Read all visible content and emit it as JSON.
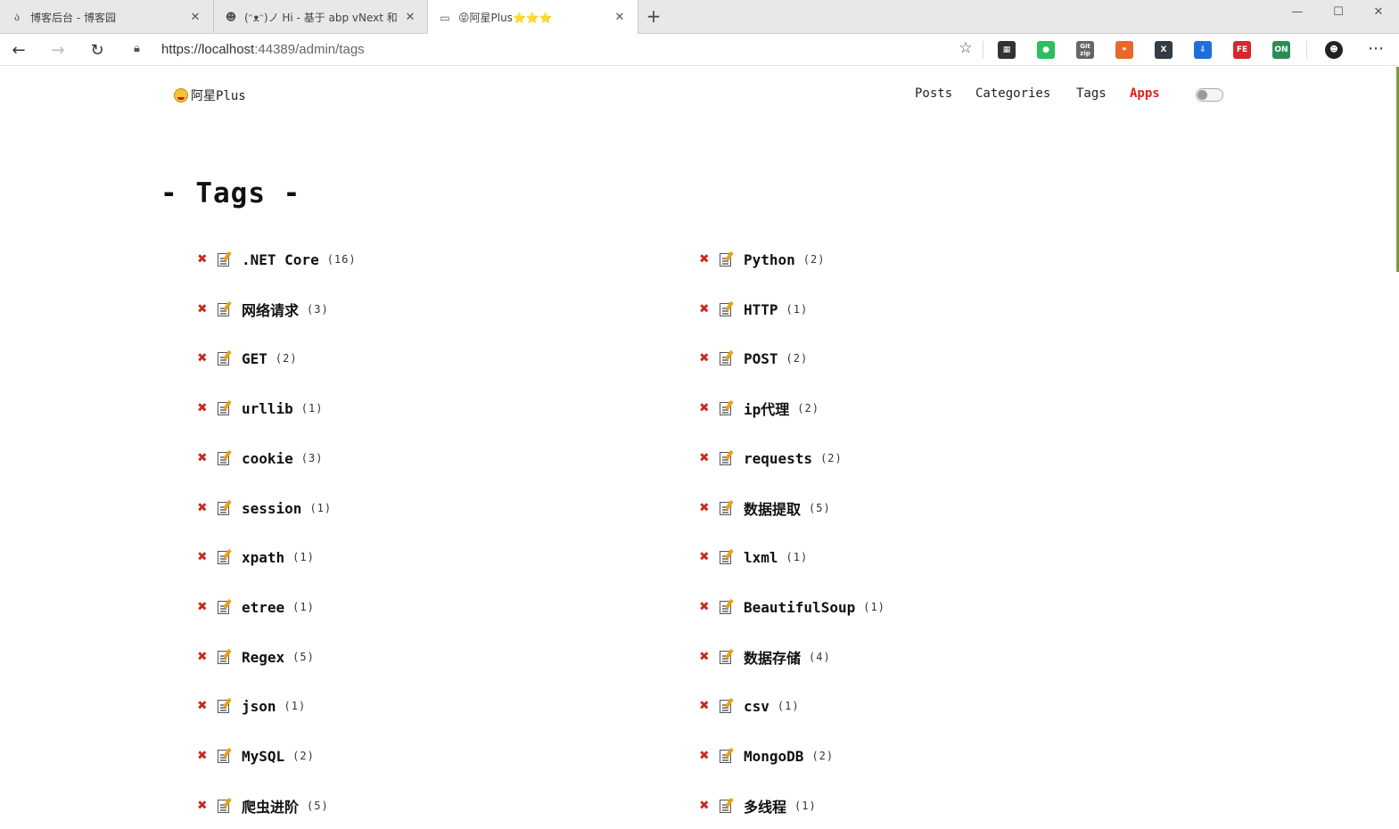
{
  "browser": {
    "tabs": [
      {
        "title": "博客后台 - 博客园",
        "icon": "blog-icon"
      },
      {
        "title": "(ᵔᴥᵔ)ノ Hi - 基于 abp vNext 和",
        "icon": "avatar-icon"
      },
      {
        "title": "😝阿星Plus⭐⭐⭐",
        "icon": "page-icon"
      }
    ],
    "active_tab": 2,
    "url_prefix": "https://localhost",
    "url_suffix": ":44389/admin/tags",
    "extensions": [
      {
        "name": "qr-code-icon",
        "label": "▦",
        "color": "#333333"
      },
      {
        "name": "evernote-icon",
        "label": "●",
        "color": "#2dbe60"
      },
      {
        "name": "git-zip-icon",
        "label": "Git zip",
        "color": "#666666"
      },
      {
        "name": "graph-icon",
        "label": "⚭",
        "color": "#e8672a"
      },
      {
        "name": "x-extension-icon",
        "label": "X",
        "color": "#333b44"
      },
      {
        "name": "save-icon",
        "label": "⇩",
        "color": "#1e6fd9"
      },
      {
        "name": "fe-helper-icon",
        "label": "FE",
        "color": "#d8262c"
      },
      {
        "name": "on-switch-icon",
        "label": "ON",
        "color": "#2e8b57"
      },
      {
        "name": "profile-avatar-icon",
        "label": "☻",
        "color": "#222222"
      }
    ]
  },
  "site": {
    "brand": "阿星Plus",
    "menu": [
      "Posts",
      "Categories",
      "Tags",
      "Apps"
    ],
    "active_menu": "Apps"
  },
  "page": {
    "title": "- Tags -",
    "left": [
      {
        "name": ".NET Core",
        "count": "(16)"
      },
      {
        "name": "网络请求",
        "count": "(3)"
      },
      {
        "name": "GET",
        "count": "(2)"
      },
      {
        "name": "urllib",
        "count": "(1)"
      },
      {
        "name": "cookie",
        "count": "(3)"
      },
      {
        "name": "session",
        "count": "(1)"
      },
      {
        "name": "xpath",
        "count": "(1)"
      },
      {
        "name": "etree",
        "count": "(1)"
      },
      {
        "name": "Regex",
        "count": "(5)"
      },
      {
        "name": "json",
        "count": "(1)"
      },
      {
        "name": "MySQL",
        "count": "(2)"
      },
      {
        "name": "爬虫进阶",
        "count": "(5)"
      }
    ],
    "right": [
      {
        "name": "Python",
        "count": "(2)"
      },
      {
        "name": "HTTP",
        "count": "(1)"
      },
      {
        "name": "POST",
        "count": "(2)"
      },
      {
        "name": "ip代理",
        "count": "(2)"
      },
      {
        "name": "requests",
        "count": "(2)"
      },
      {
        "name": "数据提取",
        "count": "(5)"
      },
      {
        "name": "lxml",
        "count": "(1)"
      },
      {
        "name": "BeautifulSoup",
        "count": "(1)"
      },
      {
        "name": "数据存储",
        "count": "(4)"
      },
      {
        "name": "csv",
        "count": "(1)"
      },
      {
        "name": "MongoDB",
        "count": "(2)"
      },
      {
        "name": "多线程",
        "count": "(1)"
      }
    ]
  },
  "colors": {
    "accent": "#e0201a",
    "delete": "#c82a1e"
  }
}
